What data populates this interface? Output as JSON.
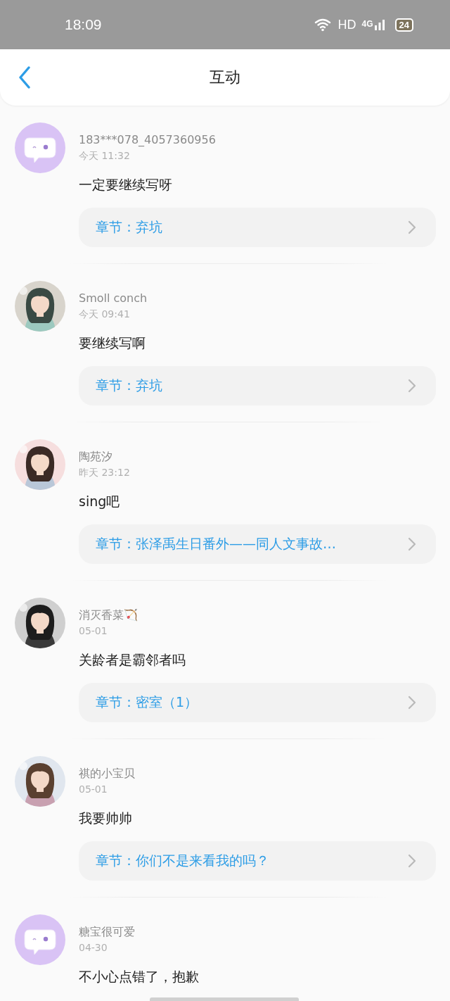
{
  "status_bar": {
    "time": "18:09",
    "hd": "HD",
    "network": "4G",
    "battery": "24"
  },
  "header": {
    "title": "互动"
  },
  "comments": [
    {
      "avatar": {
        "kind": "default"
      },
      "name": "183***078_4057360956",
      "time": "今天 11:32",
      "text": "一定要继续写呀",
      "chapter": "章节：弃坑"
    },
    {
      "name": "Smoll conch",
      "time": "今天 09:41",
      "text": "要继续写啊",
      "chapter": "章节：弃坑"
    },
    {
      "name": "陶苑汐",
      "time": "昨天 23:12",
      "text": "sing吧",
      "chapter": "章节：张泽禹生日番外——同人文事故…"
    },
    {
      "name": "消灭香菜🏹",
      "time": "05-01",
      "text": "关龄者是霸邻者吗",
      "chapter": "章节：密室（1）"
    },
    {
      "name": "祺的小宝贝",
      "time": "05-01",
      "text": "我要帅帅",
      "chapter": "章节：你们不是来看我的吗？"
    },
    {
      "avatar": {
        "kind": "default"
      },
      "name": "糖宝很可爱",
      "time": "04-30",
      "text": "不小心点错了，抱歉"
    }
  ]
}
